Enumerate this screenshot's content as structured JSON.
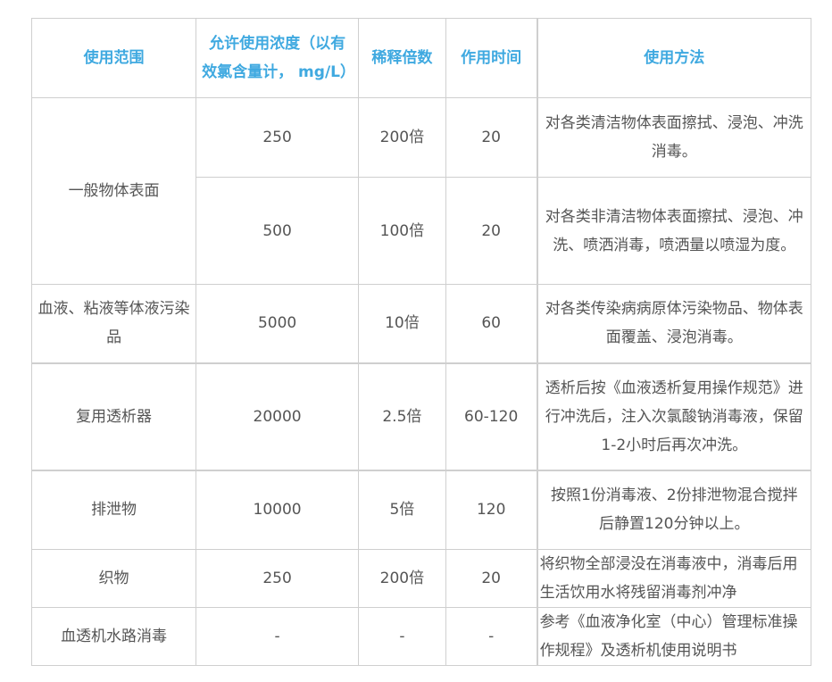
{
  "table": {
    "headers": [
      "使用范围",
      "允许使用浓度（以有效氯含量计， mg/L）",
      "稀释倍数",
      "作用时间",
      "使用方法"
    ],
    "rows": {
      "general_surface": {
        "scope": "一般物体表面",
        "a": {
          "concentration": "250",
          "dilution": "200倍",
          "time": "20",
          "method": "对各类清洁物体表面擦拭、浸泡、冲洗消毒。"
        },
        "b": {
          "concentration": "500",
          "dilution": "100倍",
          "time": "20",
          "method": "对各类非清洁物体表面擦拭、浸泡、冲洗、喷洒消毒，喷洒量以喷湿为度。"
        }
      },
      "blood": {
        "scope": "血液、粘液等体液污染品",
        "concentration": "5000",
        "dilution": "10倍",
        "time": "60",
        "method": "对各类传染病病原体污染物品、物体表面覆盖、浸泡消毒。"
      },
      "dialyzer": {
        "scope": "复用透析器",
        "concentration": "20000",
        "dilution": "2.5倍",
        "time": "60-120",
        "method": "透析后按《血液透析复用操作规范》进行冲洗后，注入次氯酸钠消毒液，保留1-2小时后再次冲洗。"
      },
      "excreta": {
        "scope": "排泄物",
        "concentration": "10000",
        "dilution": "5倍",
        "time": "120",
        "method": "按照1份消毒液、2份排泄物混合搅拌后静置120分钟以上。"
      },
      "fabric": {
        "scope": "织物",
        "concentration": "250",
        "dilution": "200倍",
        "time": "20",
        "method": "将织物全部浸没在消毒液中，消毒后用生活饮用水将残留消毒剂冲净"
      },
      "dialysis_water": {
        "scope": "血透机水路消毒",
        "concentration": "-",
        "dilution": "-",
        "time": "-",
        "method": "参考《血液净化室（中心）管理标准操作规程》及透析机使用说明书"
      }
    }
  }
}
